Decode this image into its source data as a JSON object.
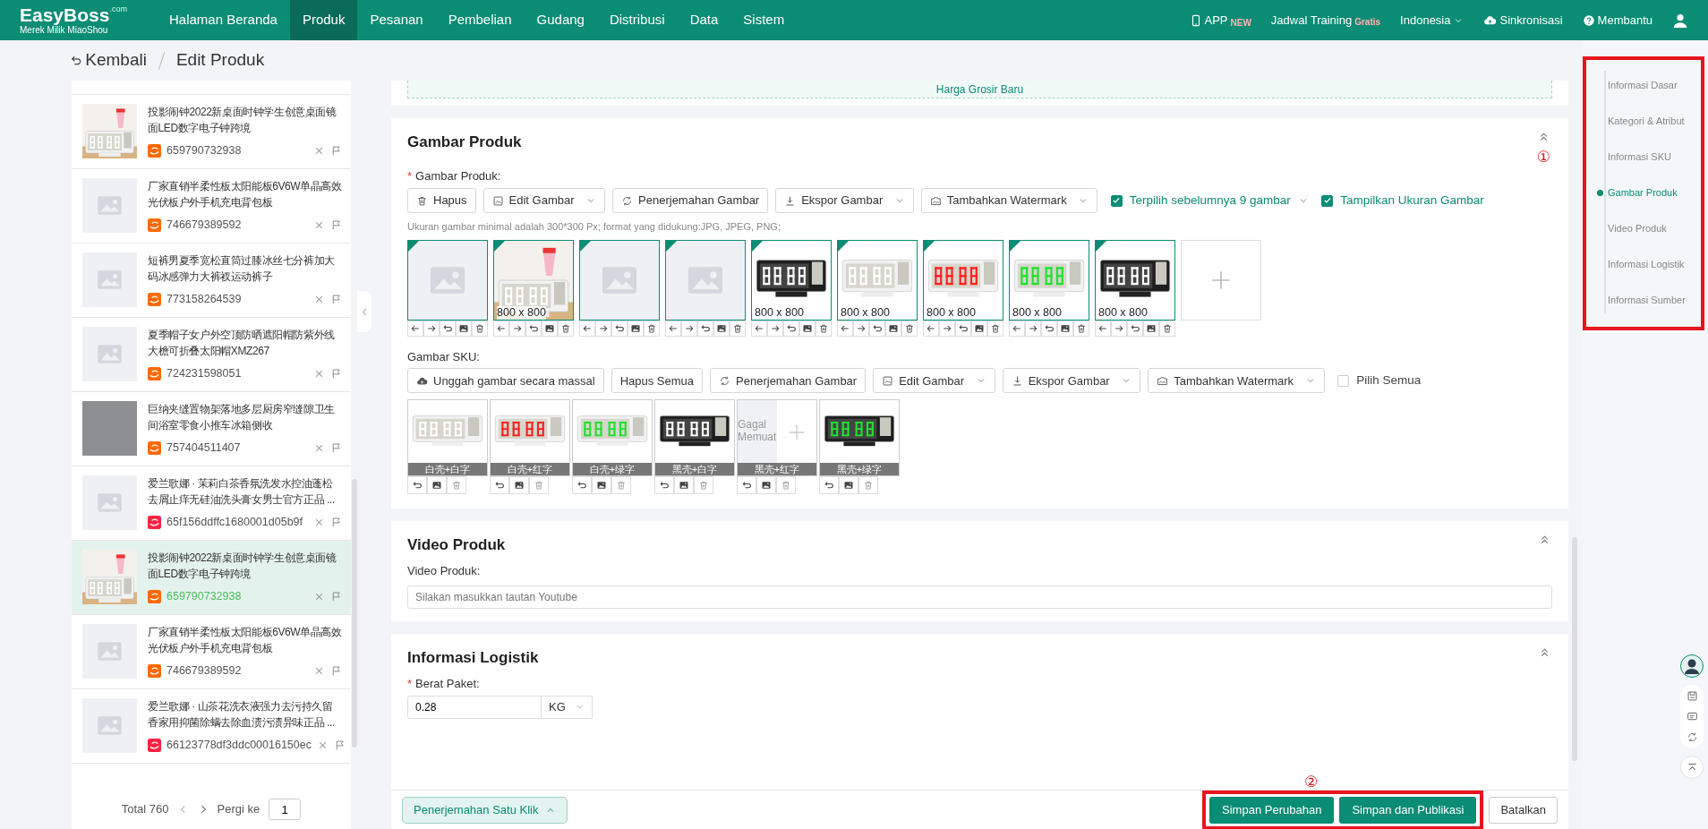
{
  "header": {
    "logo": {
      "name": "EasyBoss",
      "suffix": ".com",
      "tagline": "Merek Milik MiaoShou"
    },
    "nav": [
      {
        "label": "Halaman Beranda",
        "selected": false
      },
      {
        "label": "Produk",
        "selected": true
      },
      {
        "label": "Pesanan",
        "selected": false
      },
      {
        "label": "Pembelian",
        "selected": false
      },
      {
        "label": "Gudang",
        "selected": false
      },
      {
        "label": "Distribusi",
        "selected": false
      },
      {
        "label": "Data",
        "selected": false
      },
      {
        "label": "Sistem",
        "selected": false
      }
    ],
    "app": {
      "label": "APP",
      "badge": "NEW"
    },
    "training": {
      "label": "Jadwal Training",
      "badge": "Gratis"
    },
    "language": "Indonesia",
    "sync": "Sinkronisasi",
    "help": "Membantu"
  },
  "breadcrumb": {
    "back": "Kembali",
    "current": "Edit Produk"
  },
  "product_list": {
    "items": [
      {
        "title": "投影闹钟2022新桌面时钟学生创意桌面镜面LED数字电子钟跨境",
        "id": "659790732938",
        "color": "#ff6a00",
        "kind": "projector",
        "selected": false
      },
      {
        "title": "厂家直销半柔性板太阳能板6V6W单晶高效光伏板户外手机充电背包板",
        "id": "746679389592",
        "color": "#ff6a00",
        "kind": "placeholder",
        "selected": false
      },
      {
        "title": "短裤男夏季宽松直筒过膝冰丝七分裤加大码冰感弹力大裤衩运动裤子",
        "id": "773158264539",
        "color": "#ff6a00",
        "kind": "placeholder",
        "selected": false
      },
      {
        "title": "夏季帽子女户外空顶防晒遮阳帽防紫外线大檐可折叠太阳帽XMZ267",
        "id": "724231598051",
        "color": "#ff6a00",
        "kind": "placeholder",
        "selected": false
      },
      {
        "title": "巨纳夹缝置物架落地多层厨房窄缝隙卫生间浴室零食小推车冰箱侧收",
        "id": "757404511407",
        "color": "#ff6a00",
        "kind": "photo",
        "selected": false
      },
      {
        "title": "爱兰歌娜 · 茉莉白茶香氛洗发水控油蓬松去屑止痒无硅油洗头膏女男士官方正品 ...",
        "id": "65f156ddffc1680001d05b9f",
        "color": "#ff2442",
        "kind": "placeholder",
        "selected": false
      },
      {
        "title": "投影闹钟2022新桌面时钟学生创意桌面镜面LED数字电子钟跨境",
        "id": "659790732938",
        "color": "#ff6a00",
        "kind": "projector",
        "selected": true
      },
      {
        "title": "厂家直销半柔性板太阳能板6V6W单晶高效光伏板户外手机充电背包板",
        "id": "746679389592",
        "color": "#ff6a00",
        "kind": "placeholder",
        "selected": false
      },
      {
        "title": "爱兰歌娜 · 山茶花洗衣液强力去污持久留香家用抑菌除螨去除血渍污渍异味正品 ...",
        "id": "66123778df3ddc00016150ec",
        "color": "#ff2442",
        "kind": "placeholder",
        "selected": false
      }
    ],
    "total": "Total 760",
    "goto_label": "Pergi ke",
    "page": "1"
  },
  "wholesale": {
    "button": "Harga Grosir Baru"
  },
  "gambar_produk": {
    "title": "Gambar Produk",
    "marker": "①",
    "field_label": "Gambar Produk:",
    "required": "*",
    "toolbar": [
      {
        "kind": "delete",
        "label": "Hapus",
        "dropdown": false
      },
      {
        "kind": "edit",
        "label": "Edit Gambar",
        "dropdown": true
      },
      {
        "kind": "translate",
        "label": "Penerjemahan Gambar",
        "dropdown": false
      },
      {
        "kind": "export",
        "label": "Ekspor Gambar",
        "dropdown": true
      },
      {
        "kind": "watermark",
        "label": "Tambahkan Watermark",
        "dropdown": true
      },
      {
        "kind": "checkbox",
        "label": "Terpilih sebelumnya 9 gambar",
        "checked": true,
        "dropdown": true
      },
      {
        "kind": "checkbox",
        "label": "Tampilkan Ukuran Gambar",
        "checked": true,
        "dropdown": false
      }
    ],
    "hint": "Ukuran gambar minimal adalah 300*300 Px; format yang didukung:JPG, JPEG, PNG;",
    "images": [
      {
        "kind": "placeholder",
        "selected": true
      },
      {
        "kind": "projector",
        "size": "800 x 800",
        "selected": true
      },
      {
        "kind": "placeholder",
        "selected": true
      },
      {
        "kind": "placeholder",
        "selected": true
      },
      {
        "kind": "clock_black",
        "color": "#ffffff",
        "size": "800 x 800",
        "selected": true
      },
      {
        "kind": "clock_white",
        "color": "#ffffff",
        "size": "800 x 800",
        "selected": true
      },
      {
        "kind": "clock_white",
        "color": "#ff2020",
        "size": "800 x 800",
        "selected": true
      },
      {
        "kind": "clock_white",
        "color": "#22e030",
        "size": "800 x 800",
        "selected": true
      },
      {
        "kind": "clock_black",
        "color": "#ffffff",
        "size": "800 x 800",
        "selected": true
      }
    ]
  },
  "gambar_sku": {
    "field_label": "Gambar SKU:",
    "toolbar": [
      {
        "kind": "upload",
        "label": "Unggah gambar secara massal",
        "dropdown": false
      },
      {
        "kind": "plain",
        "label": "Hapus Semua",
        "dropdown": false
      },
      {
        "kind": "translate",
        "label": "Penerjemahan Gambar",
        "dropdown": false
      },
      {
        "kind": "edit",
        "label": "Edit Gambar",
        "dropdown": true
      },
      {
        "kind": "export",
        "label": "Ekspor Gambar",
        "dropdown": true
      },
      {
        "kind": "watermark",
        "label": "Tambahkan Watermark",
        "dropdown": true
      },
      {
        "kind": "checkbox",
        "label": "Pilih Semua",
        "checked": false,
        "dropdown": false
      }
    ],
    "images": [
      {
        "kind": "clock_white",
        "color": "#ffffff",
        "label": "白壳+白字"
      },
      {
        "kind": "clock_white",
        "color": "#ff2020",
        "label": "白壳+红字"
      },
      {
        "kind": "clock_white",
        "color": "#22e030",
        "label": "白壳+绿字"
      },
      {
        "kind": "clock_black",
        "color": "#ffffff",
        "label": "黑壳+白字"
      },
      {
        "kind": "failed",
        "failed_text": "Gagal Memuat",
        "label": "黑壳+红字"
      },
      {
        "kind": "clock_black",
        "color": "#22e030",
        "label": "黑壳+绿字"
      }
    ]
  },
  "video": {
    "title": "Video Produk",
    "field_label": "Video Produk:",
    "placeholder": "Silakan masukkan tautan Youtube"
  },
  "logistik": {
    "title": "Informasi Logistik",
    "field_label": "Berat Paket:",
    "required": "*",
    "value": "0.28",
    "unit": "KG"
  },
  "footer": {
    "translate": "Penerjemahan Satu Klik",
    "marker": "②",
    "highlighted": true,
    "save": "Simpan Perubahan",
    "publish": "Simpan dan Publikasi",
    "cancel": "Batalkan"
  },
  "right_nav": {
    "highlighted": true,
    "items": [
      {
        "label": "Informasi Dasar",
        "selected": false
      },
      {
        "label": "Kategori & Atribut",
        "selected": false
      },
      {
        "label": "Informasi SKU",
        "selected": false
      },
      {
        "label": "Gambar Produk",
        "selected": true
      },
      {
        "label": "Video Produk",
        "selected": false
      },
      {
        "label": "Informasi Logistik",
        "selected": false
      },
      {
        "label": "Informasi Sumber",
        "selected": false
      }
    ]
  }
}
